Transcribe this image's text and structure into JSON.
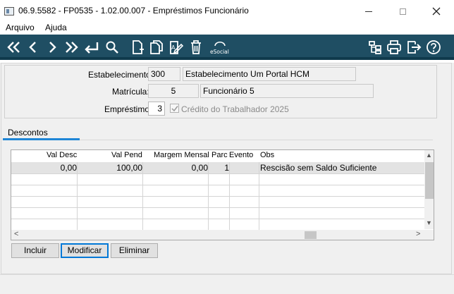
{
  "window": {
    "title": "06.9.5582 - FP0535 - 1.02.00.007 - Empréstimos Funcionário",
    "minimize_icon": "minimize-icon",
    "maximize_icon": "maximize-icon",
    "close_icon": "close-icon"
  },
  "menu": {
    "items": [
      {
        "label": "Arquivo"
      },
      {
        "label": "Ajuda"
      }
    ]
  },
  "toolbar": {
    "background": "#1f4e63",
    "buttons": [
      {
        "icon": "first-record-icon"
      },
      {
        "icon": "previous-record-icon"
      },
      {
        "icon": "next-record-icon"
      },
      {
        "icon": "last-record-icon"
      },
      {
        "icon": "return-icon"
      },
      {
        "icon": "search-icon"
      },
      {
        "icon": "new-document-icon"
      },
      {
        "icon": "copy-icon"
      },
      {
        "icon": "edit-icon"
      },
      {
        "icon": "delete-icon"
      },
      {
        "icon": "esocial-icon",
        "label": "eSocial"
      },
      {
        "icon": "tree-icon"
      },
      {
        "icon": "print-icon"
      },
      {
        "icon": "exit-icon"
      },
      {
        "icon": "help-icon"
      }
    ]
  },
  "form": {
    "estabelecimento": {
      "label": "Estabelecimento:",
      "code": "300",
      "description": "Estabelecimento Um Portal HCM"
    },
    "matricula": {
      "label": "Matrícula:",
      "code": "5",
      "description": "Funcionário 5"
    },
    "emprestimo": {
      "label": "Empréstimo:",
      "code": "3",
      "description": "Crédito do Trabalhador 2025",
      "checked": true
    }
  },
  "tabs": [
    {
      "label": "Descontos",
      "active": true
    }
  ],
  "grid": {
    "columns": [
      "Val Desc",
      "Val Pend",
      "Margem Mensal",
      "Parc",
      "Evento",
      "Obs"
    ],
    "rows": [
      {
        "val_desc": "0,00",
        "val_pend": "100,00",
        "margem_mensal": "0,00",
        "parc": "1",
        "evento": "",
        "obs": "Rescisão sem Saldo Suficiente"
      }
    ]
  },
  "buttons": {
    "incluir": "Incluir",
    "modificar": "Modificar",
    "eliminar": "Eliminar"
  },
  "colors": {
    "toolbar": "#1f4e63",
    "accent": "#1f86d6",
    "focus": "#0078d7"
  }
}
